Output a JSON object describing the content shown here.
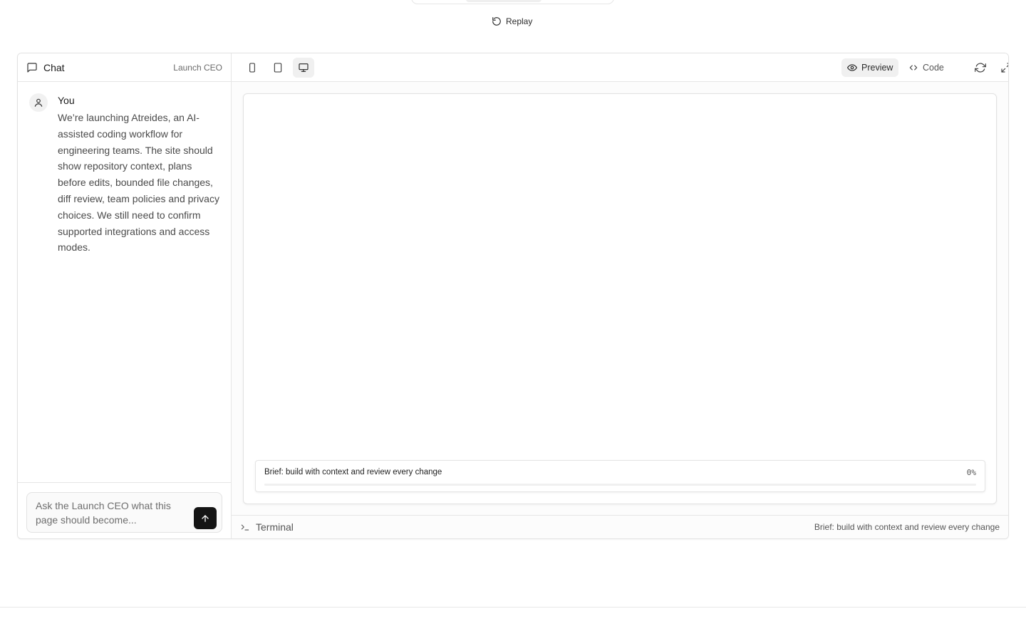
{
  "replay": {
    "label": "Replay",
    "icon": "rotate-ccw-icon"
  },
  "chat": {
    "title": "Chat",
    "subtitle": "Launch CEO",
    "messages": [
      {
        "author": "You",
        "text": "We’re launching Atreides, an AI-assisted coding workflow for engineering teams. The site should show repository context, plans before edits, bounded file changes, diff review, team policies and privacy choices. We still need to confirm supported integrations and access modes."
      }
    ],
    "composer": {
      "placeholder": "Ask the Launch CEO what this page should become...",
      "value": ""
    }
  },
  "toolbar": {
    "devices": [
      "mobile",
      "tablet",
      "desktop"
    ],
    "active_device": "desktop",
    "preview_label": "Preview",
    "code_label": "Code",
    "active_view": "preview"
  },
  "preview": {
    "brief_label": "Brief: build with context and review every change",
    "progress_text": "0%",
    "progress_value": 0
  },
  "terminal": {
    "label": "Terminal",
    "status": "Brief: build with context and review every change"
  },
  "colors": {
    "accent": "#141414",
    "border": "#e2e2e2",
    "muted_text": "#6b6b6b"
  }
}
